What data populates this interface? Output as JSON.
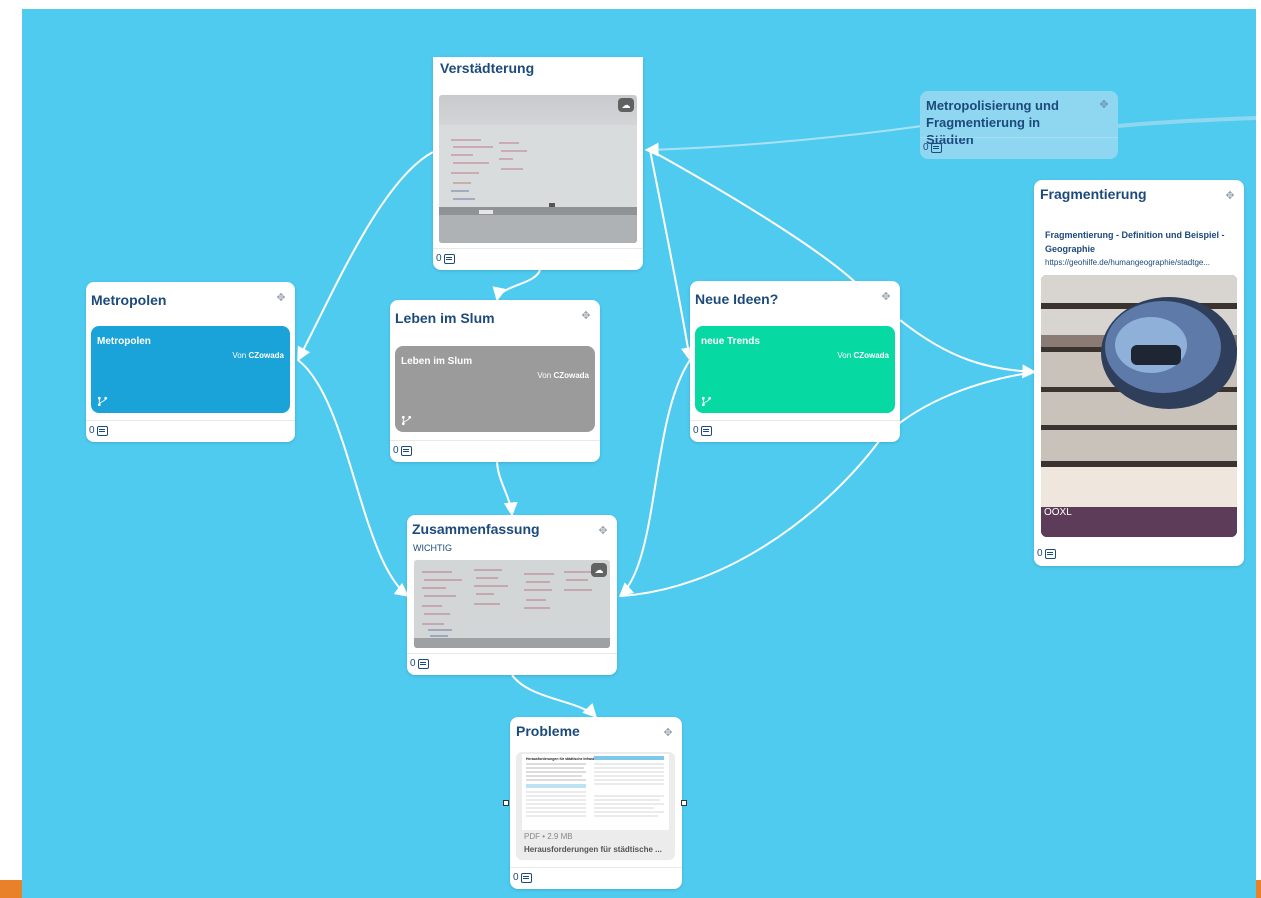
{
  "colors": {
    "canvas": "#4fcbf0",
    "title": "#1c4a7c",
    "metropolen_tile": "#1aa3d8",
    "slum_tile": "#9b9b9b",
    "trends_tile": "#07d9a2",
    "connector": "#ffffff"
  },
  "cards": {
    "verstaedterung": {
      "title": "Verstädterung",
      "comments": "0"
    },
    "metropolisierung": {
      "title": "Metropolisierung und Fragmentierung in Städten",
      "comments": "0"
    },
    "metropolen": {
      "title": "Metropolen",
      "comments": "0",
      "link": {
        "title": "Metropolen",
        "author_prefix": "Von",
        "author": "CZowada"
      }
    },
    "slum": {
      "title": "Leben im Slum",
      "comments": "0",
      "link": {
        "title": "Leben im Slum",
        "author_prefix": "Von",
        "author": "CZowada"
      }
    },
    "neue_ideen": {
      "title": "Neue Ideen?",
      "comments": "0",
      "link": {
        "title": "neue Trends",
        "author_prefix": "Von",
        "author": "CZowada"
      }
    },
    "fragmentierung": {
      "title": "Fragmentierung",
      "comments": "0",
      "link_title": "Fragmentierung - Definition und Beispiel - Geographie",
      "link_url": "https://geohilfe.de/humangeographie/stadtge...",
      "photo_caption": "OOXL"
    },
    "zusammenfassung": {
      "title": "Zusammenfassung",
      "subtitle": "WICHTIG",
      "comments": "0"
    },
    "probleme": {
      "title": "Probleme",
      "comments": "0",
      "file_meta": "PDF • 2.9 MB",
      "file_name": "Herausforderungen für städtische ...",
      "doc_heading": "Herausforderungen für städtische Infrastruktur"
    }
  },
  "icons": {
    "move": "move-icon",
    "comment": "comment-icon",
    "upload": "cloud-upload-icon",
    "branch": "branch-icon"
  }
}
